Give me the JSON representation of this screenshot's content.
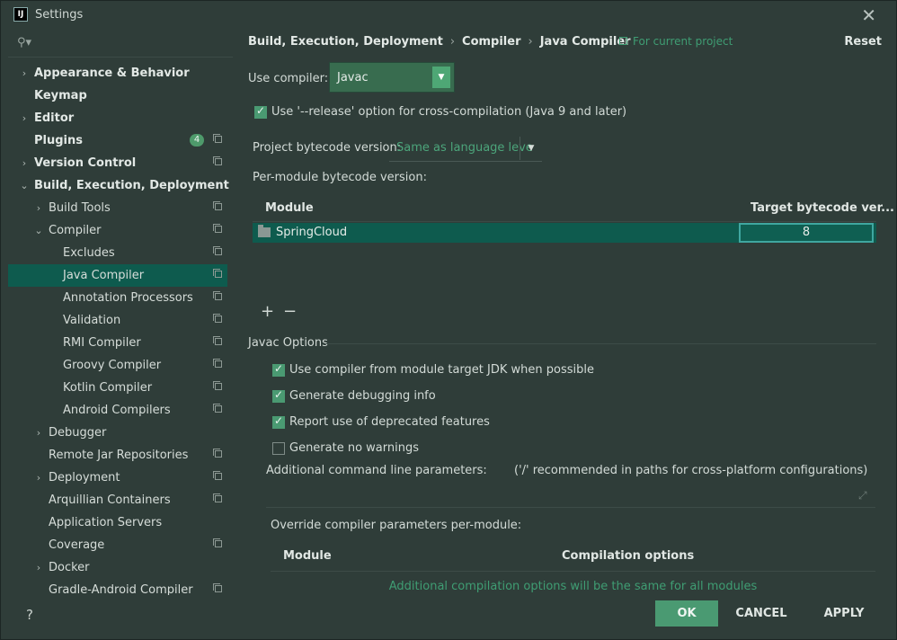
{
  "window": {
    "title": "Settings",
    "app_icon_text": "IJ"
  },
  "sidebar": {
    "search_placeholder": "",
    "items": [
      {
        "label": "Appearance & Behavior",
        "arrow": "›",
        "bold": true
      },
      {
        "label": "Keymap",
        "arrow": "",
        "bold": true
      },
      {
        "label": "Editor",
        "arrow": "›",
        "bold": true
      },
      {
        "label": "Plugins",
        "arrow": "",
        "bold": true,
        "badge": "4"
      },
      {
        "label": "Version Control",
        "arrow": "›",
        "bold": true
      },
      {
        "label": "Build, Execution, Deployment",
        "arrow": "⌄",
        "bold": true
      },
      {
        "label": "Build Tools",
        "arrow": "›"
      },
      {
        "label": "Compiler",
        "arrow": "⌄"
      },
      {
        "label": "Excludes",
        "arrow": ""
      },
      {
        "label": "Java Compiler",
        "arrow": "",
        "selected": true
      },
      {
        "label": "Annotation Processors",
        "arrow": ""
      },
      {
        "label": "Validation",
        "arrow": ""
      },
      {
        "label": "RMI Compiler",
        "arrow": ""
      },
      {
        "label": "Groovy Compiler",
        "arrow": ""
      },
      {
        "label": "Kotlin Compiler",
        "arrow": ""
      },
      {
        "label": "Android Compilers",
        "arrow": ""
      },
      {
        "label": "Debugger",
        "arrow": "›"
      },
      {
        "label": "Remote Jar Repositories",
        "arrow": ""
      },
      {
        "label": "Deployment",
        "arrow": "›"
      },
      {
        "label": "Arquillian Containers",
        "arrow": ""
      },
      {
        "label": "Application Servers",
        "arrow": ""
      },
      {
        "label": "Coverage",
        "arrow": ""
      },
      {
        "label": "Docker",
        "arrow": "›"
      },
      {
        "label": "Gradle-Android Compiler",
        "arrow": ""
      }
    ]
  },
  "breadcrumb": {
    "part1": "Build, Execution, Deployment",
    "sep": "›",
    "part2": "Compiler",
    "part3": "Java Compiler"
  },
  "for_current_project": "For current project",
  "reset": "Reset",
  "use_compiler": {
    "label": "Use compiler:",
    "value": "Javac"
  },
  "release_option": {
    "label": "Use '--release' option for cross-compilation (Java 9 and later)",
    "checked": true
  },
  "project_bytecode": {
    "label": "Project bytecode version:",
    "value": "Same as language leve"
  },
  "per_module": {
    "label": "Per-module bytecode version:",
    "columns": [
      "Module",
      "Target bytecode ver..."
    ],
    "rows": [
      {
        "module": "SpringCloud",
        "target": "8"
      }
    ],
    "add": "+",
    "remove": "−"
  },
  "javac_options": {
    "title": "Javac Options",
    "checkboxes": [
      {
        "label": "Use compiler from module target JDK when possible",
        "checked": true
      },
      {
        "label": "Generate debugging info",
        "checked": true
      },
      {
        "label": "Report use of deprecated features",
        "checked": true
      },
      {
        "label": "Generate no warnings",
        "checked": false
      }
    ],
    "additional_params_label": "Additional command line parameters:",
    "additional_params_hint": "('/' recommended in paths for cross-platform configurations)"
  },
  "override": {
    "title": "Override compiler parameters per-module:",
    "columns": [
      "Module",
      "Compilation options"
    ],
    "empty_text": "Additional compilation options will be the same for all modules"
  },
  "buttons": {
    "ok": "OK",
    "cancel": "CANCEL",
    "apply": "APPLY"
  },
  "help": "?",
  "colors": {
    "accent": "#4a9a72",
    "selection": "#0e5b4e",
    "link": "#3f9d73"
  }
}
